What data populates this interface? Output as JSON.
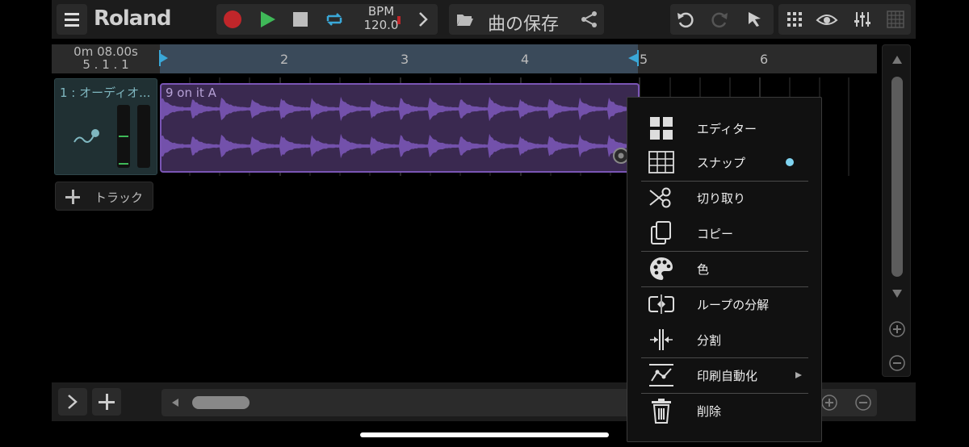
{
  "toolbar": {
    "brand": "Roland",
    "bpm_label": "BPM",
    "bpm_value": "120.0",
    "save_label": "曲の保存"
  },
  "ruler": {
    "time": "0m 08.00s",
    "position": "5 . 1 . 1",
    "bars": [
      "2",
      "3",
      "4",
      "5",
      "6"
    ]
  },
  "track": {
    "name": "1 : オーディオ...",
    "add_label": "トラック"
  },
  "clip": {
    "name": "9 on it A",
    "color": "#7a55b5"
  },
  "context_menu": {
    "items": [
      {
        "label": "エディター",
        "icon": "grid-2x2-icon"
      },
      {
        "label": "スナップ",
        "icon": "snap-grid-icon",
        "indicator_color": "#7fd3f0"
      },
      {
        "label": "切り取り",
        "icon": "scissors-icon"
      },
      {
        "label": "コピー",
        "icon": "copy-icon"
      },
      {
        "label": "色",
        "icon": "palette-icon"
      },
      {
        "label": "ループの分解",
        "icon": "loop-split-icon"
      },
      {
        "label": "分割",
        "icon": "split-icon"
      },
      {
        "label": "印刷自動化",
        "icon": "automation-icon",
        "submenu": true
      },
      {
        "label": "削除",
        "icon": "trash-icon"
      }
    ]
  },
  "colors": {
    "record": "#c0262a",
    "play": "#3fb858",
    "loop": "#3aa8d8",
    "track_accent": "#7fb7c0"
  }
}
